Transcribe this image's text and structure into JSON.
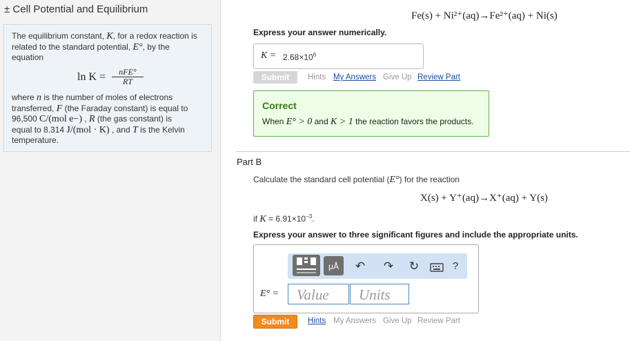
{
  "hint": {
    "title": "± Cell Potential and Equilibrium",
    "p1": [
      "The equilibrium constant, ",
      "K",
      ", for a redox reaction is",
      "related to the standard potential, ",
      "E°",
      ", by the",
      "equation"
    ],
    "equation": {
      "lhs": "ln K =",
      "num": "nFE°",
      "den": "RT"
    },
    "p2": {
      "l1a": "where ",
      "l1n": "n",
      "l1b": " is the number of moles of electrons",
      "l2a": "transferred, ",
      "l2F": "F",
      "l2b": " (the Faraday constant) is equal to",
      "l3a": "96,500 ",
      "l3u": "C/(mol e−)",
      "l3b": " , ",
      "l3R": "R",
      "l3c": " (the gas constant) is",
      "l4a": "equal to 8.314 ",
      "l4u": "J/(mol · K)",
      "l4b": " , and ",
      "l4T": "T",
      "l4c": " is the Kelvin",
      "l5": "temperature."
    }
  },
  "partA": {
    "reaction": "Fe(s) + Ni²⁺(aq)→Fe²⁺(aq) + Ni(s)",
    "prompt": "Express your answer numerically.",
    "answer_label": "K =",
    "answer_mantissa": "2.68×10",
    "answer_exp": "6",
    "submit": "Submit",
    "links": [
      "Hints",
      "My Answers",
      "Give Up",
      "Review Part"
    ],
    "feedback": {
      "title": "Correct",
      "t1": "When ",
      "e": "E° > 0",
      "t2": " and ",
      "k": "K > 1",
      "t3": " the reaction favors the products."
    }
  },
  "partB": {
    "title": "Part B",
    "intro_a": "Calculate the standard cell potential (",
    "intro_e": "E°",
    "intro_b": ") for the reaction",
    "reaction": "X(s) + Y⁺(aq)→X⁺(aq) + Y(s)",
    "cond_a": "if ",
    "cond_k": "K",
    "cond_b": " = 6.91×10",
    "cond_exp": "−3",
    "cond_c": ".",
    "prompt": "Express your answer to three significant figures and include the appropriate units.",
    "toolbar": {
      "units_label": "μÅ",
      "help": "?"
    },
    "field_label": "E° =",
    "value_placeholder": "Value",
    "units_placeholder": "Units",
    "submit": "Submit",
    "links": [
      "Hints",
      "My Answers",
      "Give Up",
      "Review Part"
    ]
  }
}
